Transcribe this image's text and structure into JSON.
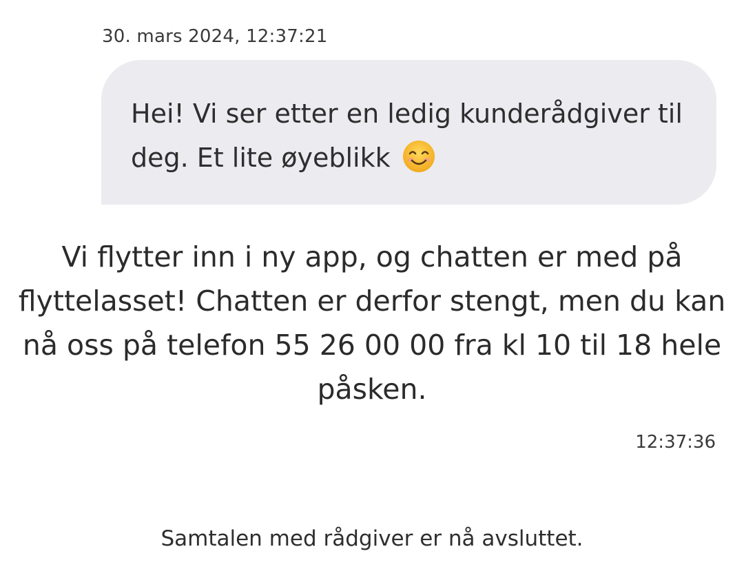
{
  "chat": {
    "first_timestamp": "30. mars 2024, 12:37:21",
    "agent_message": "Hei! Vi ser etter en ledig kunderådgiver til deg. Et lite øyeblikk",
    "agent_message_emoji": "smiling-face-emoji",
    "system_message": "Vi flytter inn i ny app, og chatten er med på flyttelasset! Chatten er derfor stengt, men du kan nå oss på telefon 55 26 00 00 fra kl 10 til 18 hele påsken.",
    "second_timestamp": "12:37:36",
    "ended_note": "Samtalen med rådgiver er nå avsluttet."
  },
  "colors": {
    "bubble_background": "#ebebf0",
    "text": "#2b2b2b",
    "emoji_face": "#f7c33b"
  }
}
